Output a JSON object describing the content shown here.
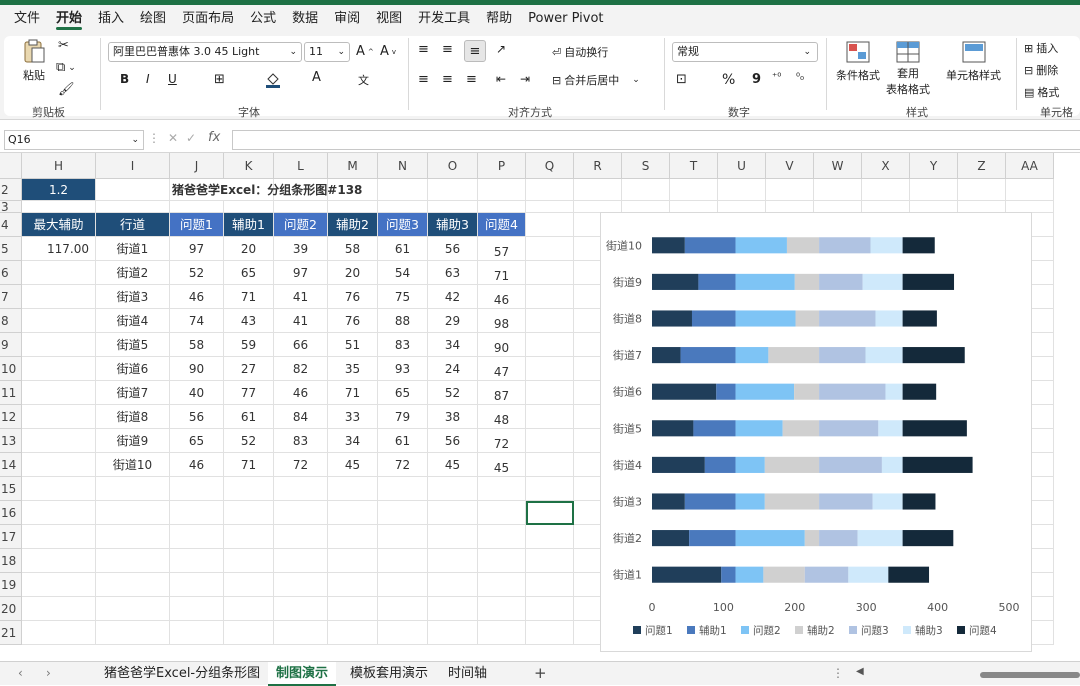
{
  "menu": [
    "文件",
    "开始",
    "插入",
    "绘图",
    "页面布局",
    "公式",
    "数据",
    "审阅",
    "视图",
    "开发工具",
    "帮助",
    "Power Pivot"
  ],
  "menu_active_index": 1,
  "ribbon": {
    "paste_label": "粘贴",
    "clipboard_label": "剪贴板",
    "font_name": "阿里巴巴普惠体 3.0 45 Light",
    "font_size": "11",
    "font_group_label": "字体",
    "bold": "B",
    "italic": "I",
    "underline": "U",
    "align_group_label": "对齐方式",
    "wrap_text": "自动换行",
    "merge_center": "合并后居中",
    "number_format": "常规",
    "number_group_label": "数字",
    "percent": "%",
    "comma": "9",
    "cond_format": "条件格式",
    "table_format_line1": "套用",
    "table_format_line2": "表格格式",
    "cell_styles": "单元格样式",
    "styles_group_label": "样式",
    "insert": "插入",
    "delete": "删除",
    "format": "格式",
    "cells_group_label": "单元格"
  },
  "formula_bar": {
    "name_box": "Q16",
    "fx": "fx",
    "formula": ""
  },
  "columns": [
    {
      "label": "H",
      "w": 74
    },
    {
      "label": "I",
      "w": 74
    },
    {
      "label": "J",
      "w": 54
    },
    {
      "label": "K",
      "w": 50
    },
    {
      "label": "L",
      "w": 54
    },
    {
      "label": "M",
      "w": 50
    },
    {
      "label": "N",
      "w": 50
    },
    {
      "label": "O",
      "w": 50
    },
    {
      "label": "P",
      "w": 48
    },
    {
      "label": "Q",
      "w": 48
    },
    {
      "label": "R",
      "w": 48
    },
    {
      "label": "S",
      "w": 48
    },
    {
      "label": "T",
      "w": 48
    },
    {
      "label": "U",
      "w": 48
    },
    {
      "label": "V",
      "w": 48
    },
    {
      "label": "W",
      "w": 48
    },
    {
      "label": "X",
      "w": 48
    },
    {
      "label": "Y",
      "w": 48
    },
    {
      "label": "Z",
      "w": 48
    },
    {
      "label": "AA",
      "w": 48
    }
  ],
  "rows": [
    "2",
    "3",
    "4",
    "5",
    "6",
    "7",
    "8",
    "9",
    "10",
    "11",
    "12",
    "13",
    "14",
    "15",
    "16",
    "17",
    "18",
    "19",
    "20",
    "21"
  ],
  "sheet": {
    "h2_value": "1.2",
    "title": "猪爸爸学Excel：分组条形图#138",
    "max_aux_label": "最大辅助",
    "max_aux_value": "117.00",
    "headers": [
      "行道",
      "问题1",
      "辅助1",
      "问题2",
      "辅助2",
      "问题3",
      "辅助3",
      "问题4"
    ],
    "table": [
      [
        "街道1",
        "97",
        "20",
        "39",
        "58",
        "61",
        "56",
        "57"
      ],
      [
        "街道2",
        "52",
        "65",
        "97",
        "20",
        "54",
        "63",
        "71"
      ],
      [
        "街道3",
        "46",
        "71",
        "41",
        "76",
        "75",
        "42",
        "46"
      ],
      [
        "街道4",
        "74",
        "43",
        "41",
        "76",
        "88",
        "29",
        "98"
      ],
      [
        "街道5",
        "58",
        "59",
        "66",
        "51",
        "83",
        "34",
        "90"
      ],
      [
        "街道6",
        "90",
        "27",
        "82",
        "35",
        "93",
        "24",
        "47"
      ],
      [
        "街道7",
        "40",
        "77",
        "46",
        "71",
        "65",
        "52",
        "87"
      ],
      [
        "街道8",
        "56",
        "61",
        "84",
        "33",
        "79",
        "38",
        "48"
      ],
      [
        "街道9",
        "65",
        "52",
        "83",
        "34",
        "61",
        "56",
        "72"
      ],
      [
        "街道10",
        "46",
        "71",
        "72",
        "45",
        "72",
        "45",
        "45"
      ]
    ]
  },
  "colors": {
    "header_dark": "#1f4e79",
    "header_mid": "#4472c4",
    "s1": "#203e5a",
    "s2": "#4a79bd",
    "s3": "#7ec4f5",
    "s4": "#d0d0d0",
    "s5": "#b0c3e2",
    "s6": "#cfe9fb",
    "s7": "#14293a"
  },
  "chart_data": {
    "type": "bar",
    "stacked": true,
    "orientation": "horizontal",
    "categories": [
      "街道10",
      "街道9",
      "街道8",
      "街道7",
      "街道6",
      "街道5",
      "街道4",
      "街道3",
      "街道2",
      "街道1"
    ],
    "series": [
      {
        "name": "问题1",
        "values": [
          46,
          65,
          56,
          40,
          90,
          58,
          74,
          46,
          52,
          97
        ]
      },
      {
        "name": "辅助1",
        "values": [
          71,
          52,
          61,
          77,
          27,
          59,
          43,
          71,
          65,
          20
        ]
      },
      {
        "name": "问题2",
        "values": [
          72,
          83,
          84,
          46,
          82,
          66,
          41,
          41,
          97,
          39
        ]
      },
      {
        "name": "辅助2",
        "values": [
          45,
          34,
          33,
          71,
          35,
          51,
          76,
          76,
          20,
          58
        ]
      },
      {
        "name": "问题3",
        "values": [
          72,
          61,
          79,
          65,
          93,
          83,
          88,
          75,
          54,
          61
        ]
      },
      {
        "name": "辅助3",
        "values": [
          45,
          56,
          38,
          52,
          24,
          34,
          29,
          42,
          63,
          56
        ]
      },
      {
        "name": "问题4",
        "values": [
          45,
          72,
          48,
          87,
          47,
          90,
          98,
          46,
          71,
          57
        ]
      }
    ],
    "xlim": [
      0,
      500
    ],
    "xticks": [
      "0",
      "100",
      "200",
      "300",
      "400",
      "500"
    ],
    "legend": "bottom"
  },
  "sheets": {
    "tabs": [
      "猪爸爸学Excel-分组条形图",
      "制图演示",
      "模板套用演示",
      "时间轴"
    ],
    "active_index": 1,
    "add": "+"
  }
}
